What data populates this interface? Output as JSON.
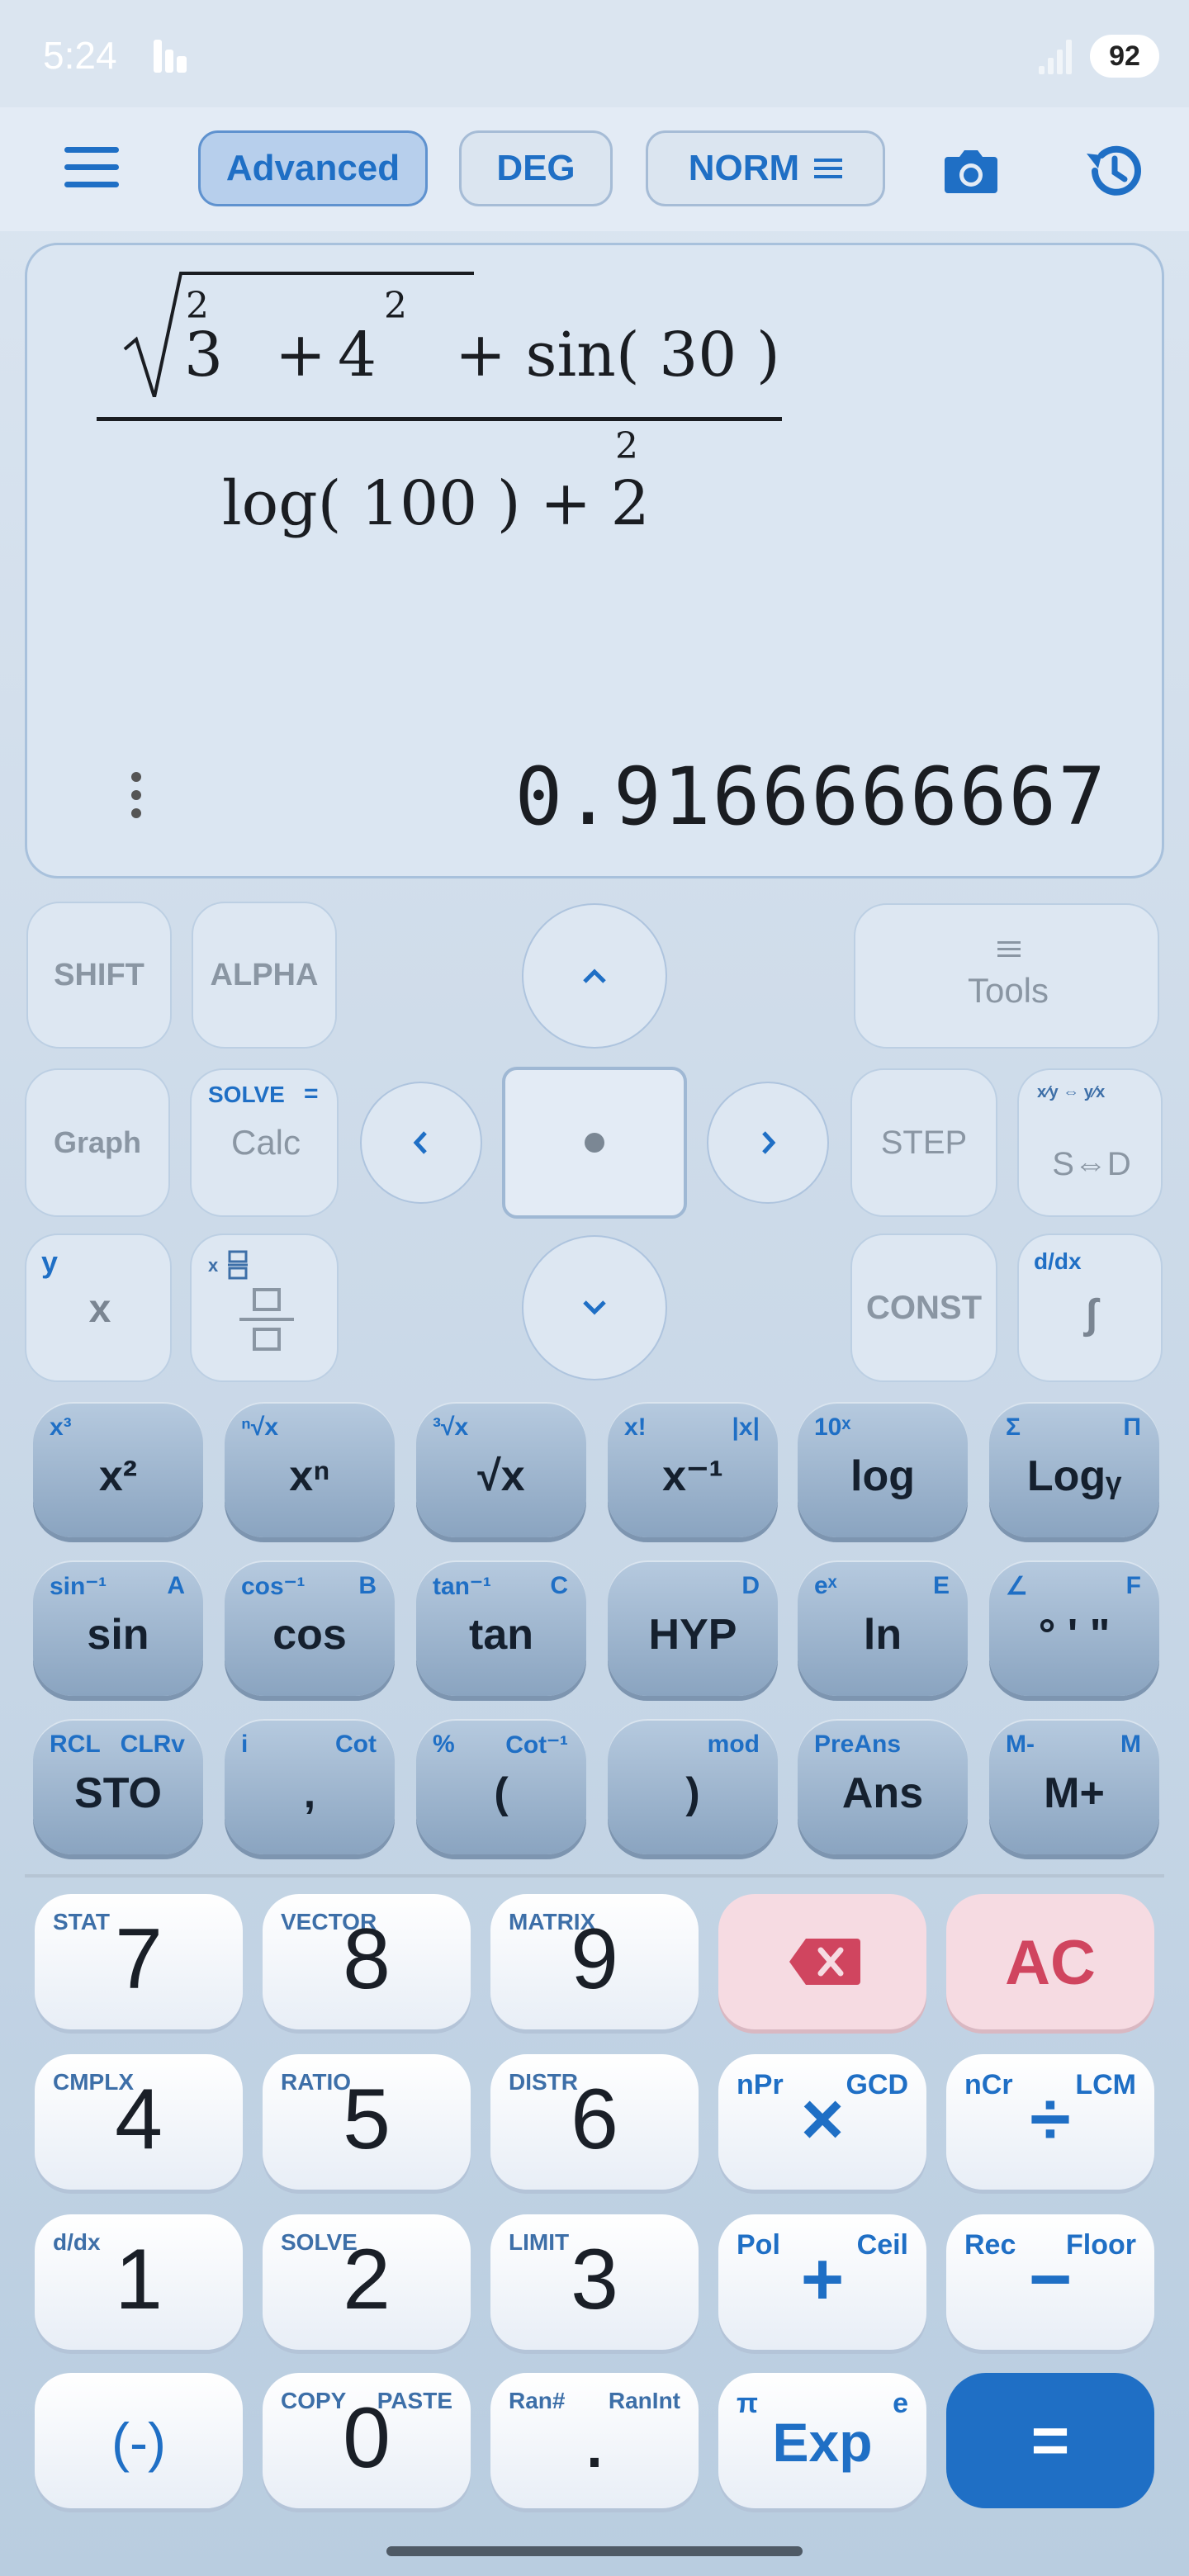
{
  "status_bar": {
    "time": "5:24",
    "battery": "92"
  },
  "toolbar": {
    "mode_advanced": "Advanced",
    "angle_unit": "DEG",
    "format_mode": "NORM"
  },
  "display": {
    "result": "0.9166666667",
    "expression": {
      "num_base1": "3",
      "num_exp1": "2",
      "num_plus": "+",
      "num_base2": "4",
      "num_exp2": "2",
      "num_tail": "+ sin( 30 )",
      "den_log": "log( 100 ) + 2",
      "den_exp": "2"
    }
  },
  "control_keys": {
    "shift": "SHIFT",
    "alpha": "ALPHA",
    "tools": "Tools",
    "graph": "Graph",
    "calc": "Calc",
    "calc_solve": "SOLVE",
    "calc_eq": "=",
    "step": "STEP",
    "sd": "S⇔D",
    "xy_y": "y",
    "xy_x": "x",
    "const": "CONST",
    "integral_sub": "d/dx",
    "integral": "∫"
  },
  "function_rows": [
    [
      {
        "main": "x²",
        "sl": "x³",
        "sr": ""
      },
      {
        "main": "xⁿ",
        "sl": "ⁿ√x",
        "sr": ""
      },
      {
        "main": "√x",
        "sl": "³√x",
        "sr": ""
      },
      {
        "main": "x⁻¹",
        "sl": "x!",
        "sr": "|x|"
      },
      {
        "main": "log",
        "sl": "10ˣ",
        "sr": ""
      },
      {
        "main": "Logᵧ",
        "sl": "Σ",
        "sr": "Π"
      }
    ],
    [
      {
        "main": "sin",
        "sl": "sin⁻¹",
        "sr": "A"
      },
      {
        "main": "cos",
        "sl": "cos⁻¹",
        "sr": "B"
      },
      {
        "main": "tan",
        "sl": "tan⁻¹",
        "sr": "C"
      },
      {
        "main": "HYP",
        "sl": "",
        "sr": "D"
      },
      {
        "main": "ln",
        "sl": "eˣ",
        "sr": "E"
      },
      {
        "main": "° ' \"",
        "sl": "∠",
        "sr": "F"
      }
    ],
    [
      {
        "main": "STO",
        "sl": "RCL",
        "sr": "CLRv"
      },
      {
        "main": ",",
        "sl": "i",
        "sr": "Cot"
      },
      {
        "main": "(",
        "sl": "%",
        "sr": "Cot⁻¹"
      },
      {
        "main": ")",
        "sl": "",
        "sr": "mod"
      },
      {
        "main": "Ans",
        "sl": "PreAns",
        "sr": ""
      },
      {
        "main": "M+",
        "sl": "M-",
        "sr": "M"
      }
    ]
  ],
  "number_rows": [
    [
      {
        "main": "7",
        "sl": "STAT",
        "sr": ""
      },
      {
        "main": "8",
        "sl": "VECTOR",
        "sr": ""
      },
      {
        "main": "9",
        "sl": "MATRIX",
        "sr": ""
      },
      {
        "main": "",
        "sl": "",
        "sr": ""
      },
      {
        "main": "AC",
        "sl": "",
        "sr": ""
      }
    ],
    [
      {
        "main": "4",
        "sl": "CMPLX",
        "sr": ""
      },
      {
        "main": "5",
        "sl": "RATIO",
        "sr": ""
      },
      {
        "main": "6",
        "sl": "DISTR",
        "sr": ""
      },
      {
        "main": "×",
        "sl": "nPr",
        "sr": "GCD"
      },
      {
        "main": "÷",
        "sl": "nCr",
        "sr": "LCM"
      }
    ],
    [
      {
        "main": "1",
        "sl": "d/dx",
        "sr": ""
      },
      {
        "main": "2",
        "sl": "SOLVE",
        "sr": ""
      },
      {
        "main": "3",
        "sl": "LIMIT",
        "sr": ""
      },
      {
        "main": "+",
        "sl": "Pol",
        "sr": "Ceil"
      },
      {
        "main": "−",
        "sl": "Rec",
        "sr": "Floor"
      }
    ],
    [
      {
        "main": "(-)",
        "sl": "",
        "sr": ""
      },
      {
        "main": "0",
        "sl": "COPY",
        "sr": "PASTE"
      },
      {
        "main": ".",
        "sl": "Ran#",
        "sr": "RanInt"
      },
      {
        "main": "Exp",
        "sl": "π",
        "sr": "e"
      },
      {
        "main": "=",
        "sl": "",
        "sr": ""
      }
    ]
  ]
}
